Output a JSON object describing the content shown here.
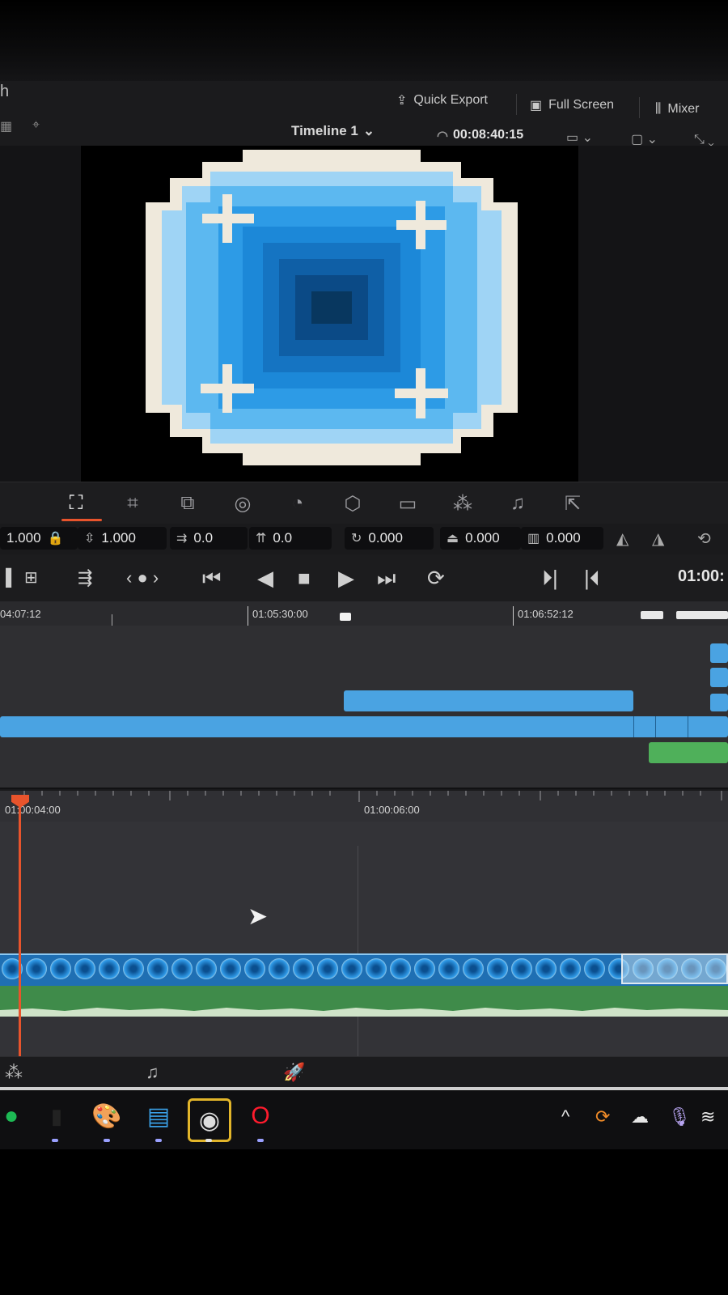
{
  "app": {
    "title_fragment": "h",
    "quick_export": "Quick Export",
    "full_screen": "Full Screen",
    "mixer": "Mixer"
  },
  "viewer": {
    "timeline_name": "Timeline 1",
    "timecode": "00:08:40:15",
    "preview_icon": "pixel-orb-icon"
  },
  "inspector": {
    "tabs": [
      {
        "name": "transform-tab-icon",
        "glyph": "⛶"
      },
      {
        "name": "crop-tab-icon",
        "glyph": "⌗"
      },
      {
        "name": "dynamic-zoom-tab-icon",
        "glyph": "⧉"
      },
      {
        "name": "composite-tab-icon",
        "glyph": "◎"
      },
      {
        "name": "speed-tab-icon",
        "glyph": "◔"
      },
      {
        "name": "stabilize-tab-icon",
        "glyph": "⬡"
      },
      {
        "name": "lens-tab-icon",
        "glyph": "▭"
      },
      {
        "name": "effects-tab-icon",
        "glyph": "⁂"
      },
      {
        "name": "audio-tab-icon",
        "glyph": "♫"
      },
      {
        "name": "export-tab-icon",
        "glyph": "⇱"
      }
    ],
    "zoom_x": "1.000",
    "zoom_y": "1.000",
    "position_x": "0.0",
    "position_y": "0.0",
    "rotation": "0.000",
    "pitch": "0.000",
    "yaw": "0.000"
  },
  "timeline": {
    "overview_ticks": [
      "04:07:12",
      "01:05:30:00",
      "01:06:52:12"
    ],
    "transport_timecode": "01:00:",
    "detail_ticks": [
      "01:00:04:00",
      "01:00:06:00"
    ]
  },
  "colors": {
    "accent": "#e8542c",
    "clip_blue": "#4aa3e2",
    "clip_green": "#4fb05a",
    "playhead": "#e8542c"
  }
}
